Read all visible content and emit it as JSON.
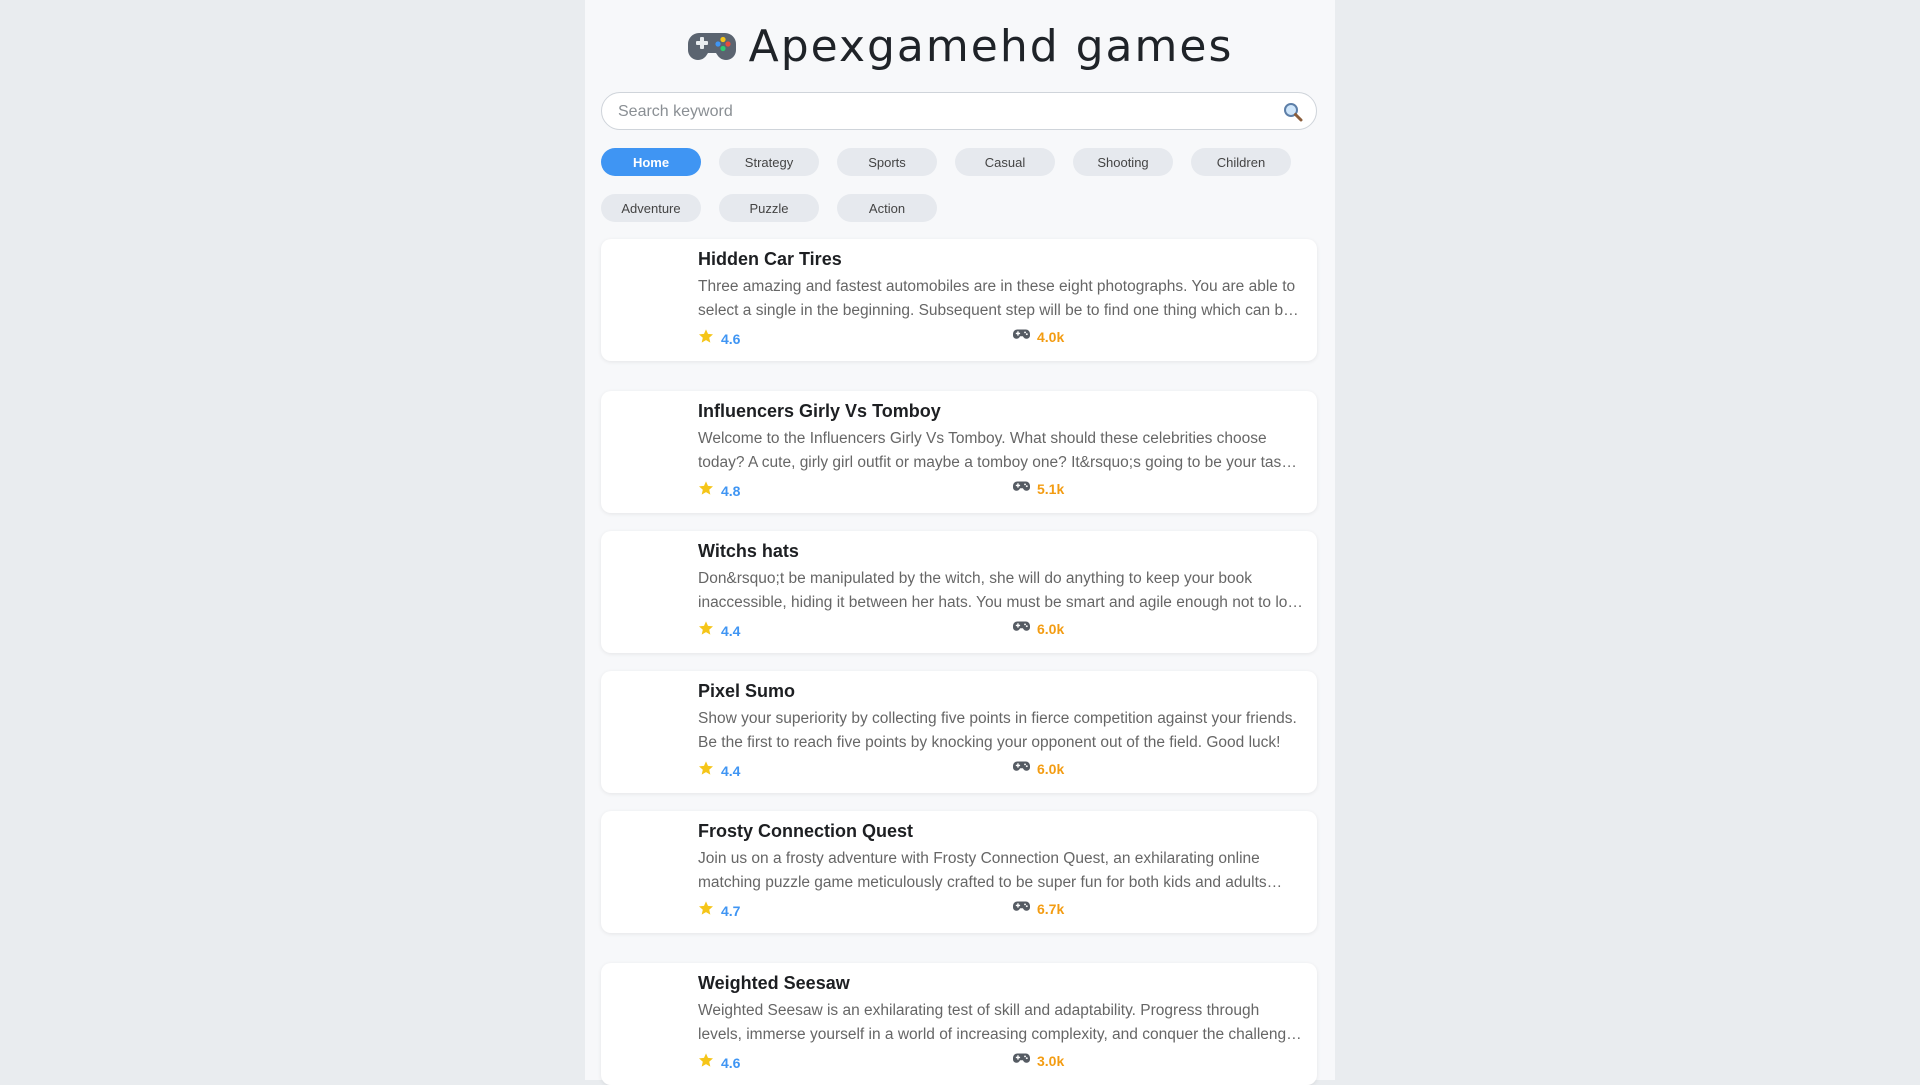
{
  "header": {
    "title": "Apexgamehd games",
    "logo_icon": "gamepad-icon"
  },
  "search": {
    "placeholder": "Search keyword",
    "value": "",
    "button_icon": "search-icon"
  },
  "categories": [
    {
      "label": "Home",
      "active": true
    },
    {
      "label": "Strategy"
    },
    {
      "label": "Sports"
    },
    {
      "label": "Casual"
    },
    {
      "label": "Shooting"
    },
    {
      "label": "Children"
    },
    {
      "label": "Adventure"
    },
    {
      "label": "Puzzle"
    },
    {
      "label": "Action"
    }
  ],
  "games": [
    {
      "title": "Hidden Car Tires",
      "description": "Three amazing and fastest automobiles are in these eight photographs. You are able to select a single in the beginning. Subsequent step will be to find one thing which can be hidden in the photos.",
      "rating": "4.6",
      "plays": "4.0k"
    },
    {
      "title": "Influencers Girly Vs Tomboy",
      "description": "Welcome to the Influencers Girly Vs Tomboy. What should these celebrities choose today? A cute, girly girl outfit or maybe a tomboy one? It&rsquo;s going to be your task to decide.",
      "rating": "4.8",
      "plays": "5.1k"
    },
    {
      "title": "Witchs hats",
      "description": "Don&rsquo;t be manipulated by the witch, she will do anything to keep your book inaccessible, hiding it between her hats. You must be smart and agile enough not to lose sight of it.",
      "rating": "4.4",
      "plays": "6.0k"
    },
    {
      "title": "Pixel Sumo",
      "description": "Show your superiority by collecting five points in fierce competition against your friends. Be the first to reach five points by knocking your opponent out of the field. Good luck!",
      "rating": "4.4",
      "plays": "6.0k"
    },
    {
      "title": "Frosty Connection Quest",
      "description": "Join us on a frosty adventure with Frosty Connection Quest, an exhilarating online matching puzzle game meticulously crafted to be super fun for both kids and adults alike.",
      "rating": "4.7",
      "plays": "6.7k"
    },
    {
      "title": "Weighted Seesaw",
      "description": "Weighted Seesaw is an exhilarating test of skill and adaptability. Progress through levels, immerse yourself in a world of increasing complexity, and conquer the challenges ahead.",
      "rating": "4.6",
      "plays": "3.0k"
    }
  ],
  "icons": {
    "rating": "star-icon",
    "plays": "gamepad-icon"
  },
  "colors": {
    "accent": "#3f95f3",
    "plays": "#f39c12",
    "star": "#f5c518"
  }
}
